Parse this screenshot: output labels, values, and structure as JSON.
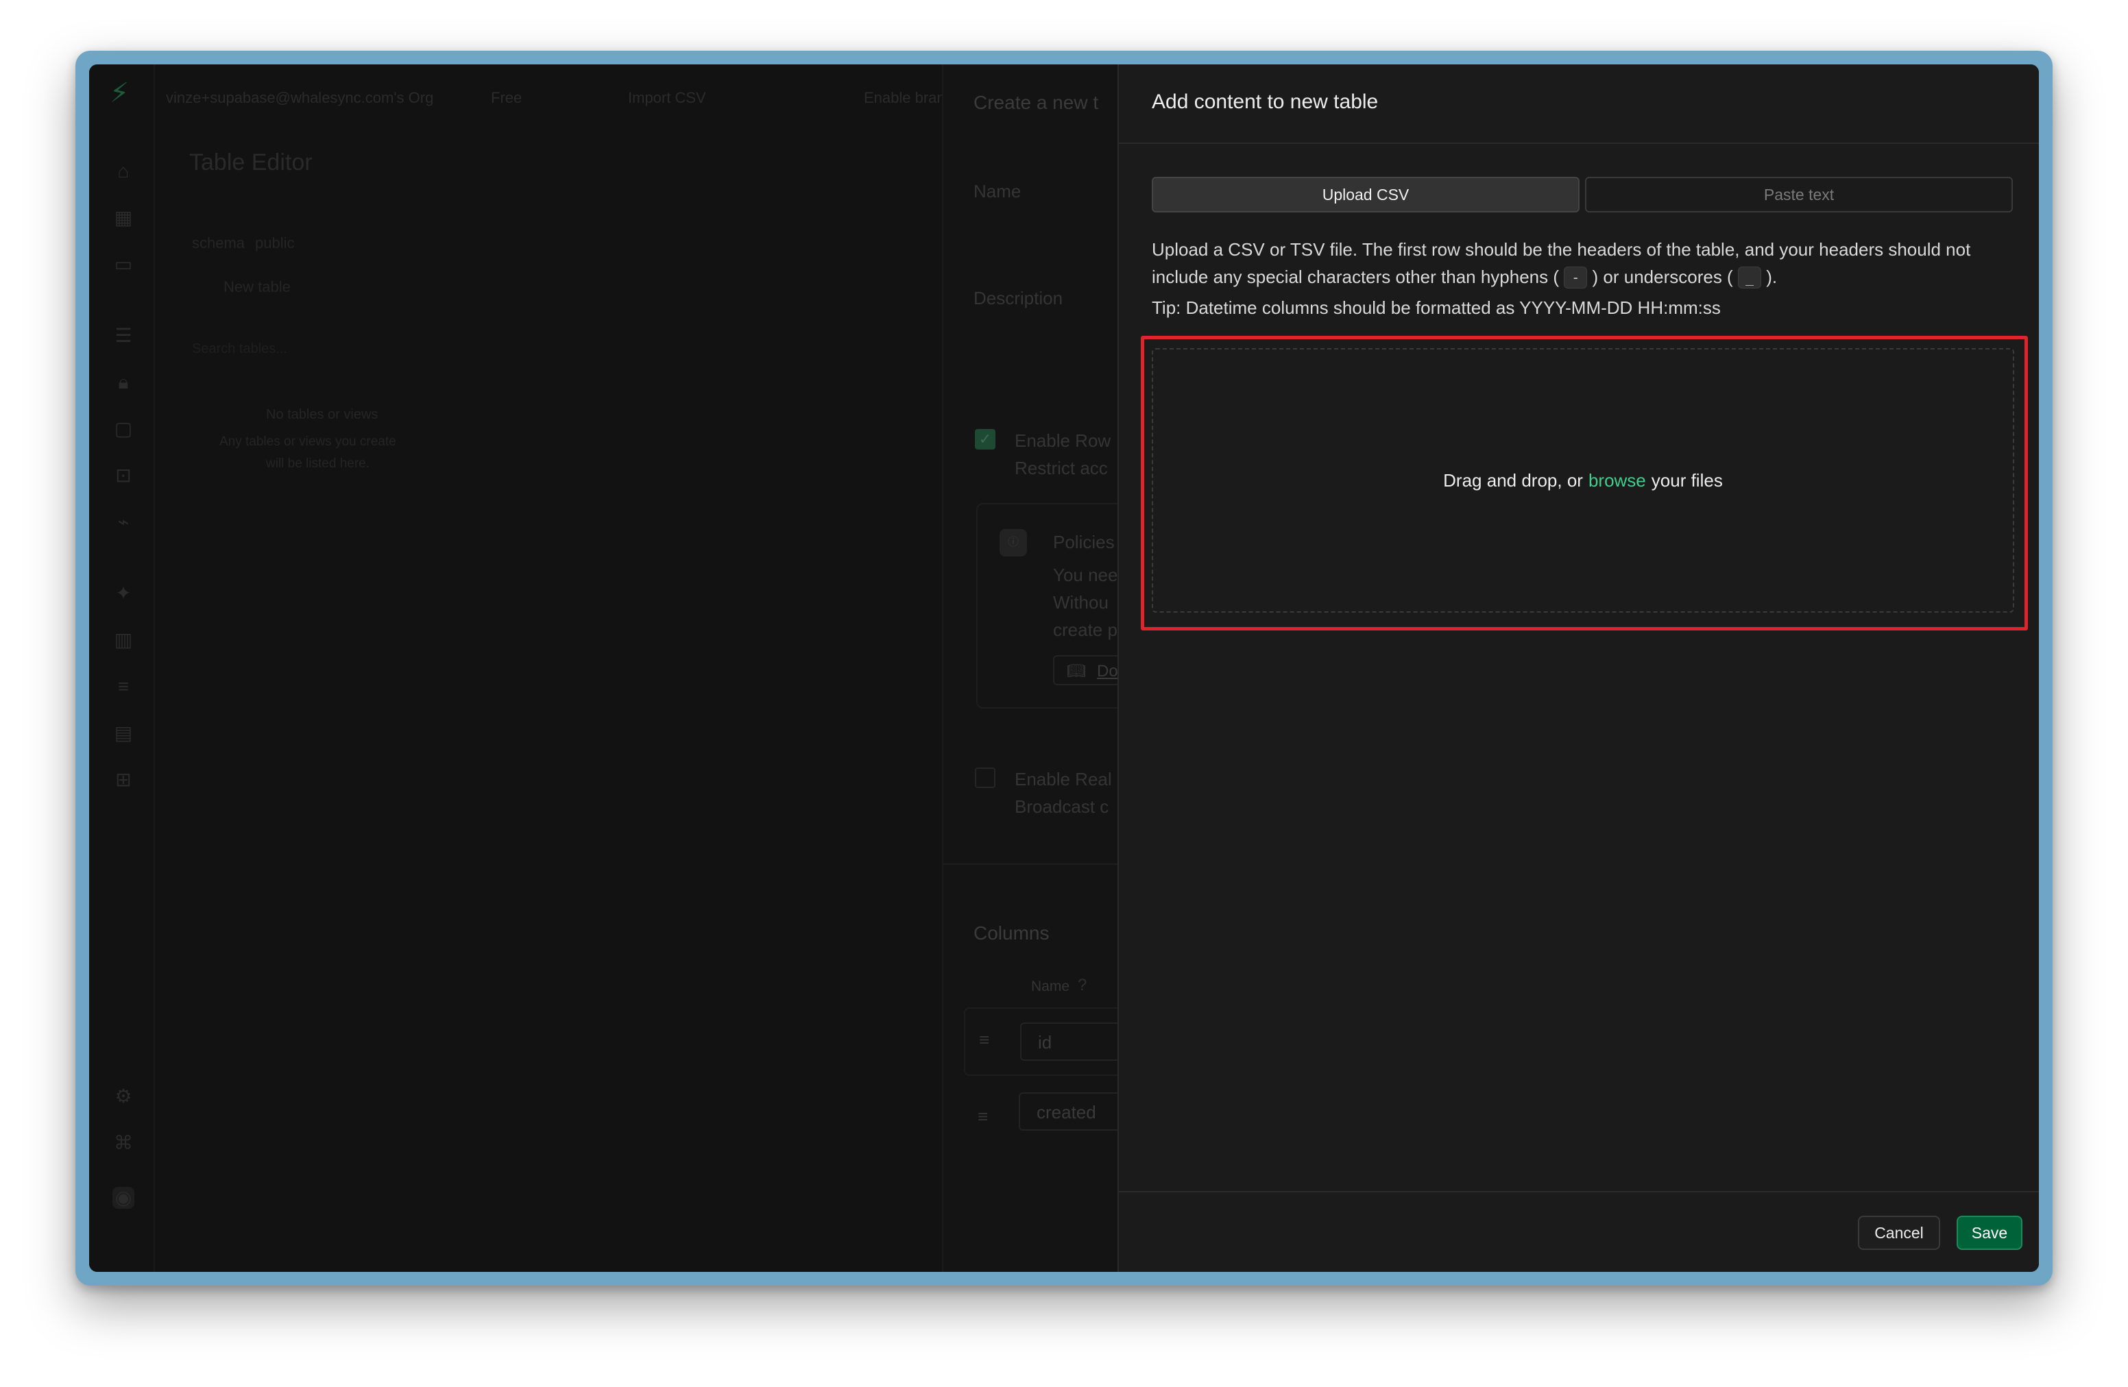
{
  "background_app": {
    "org": "vinze+supabase@whalesync.com's Org",
    "plan_badge": "Free",
    "import_csv": "Import CSV",
    "enable_branching": "Enable branching",
    "page_title": "Table Editor",
    "schema_label": "schema",
    "schema_value": "public",
    "new_table": "New table",
    "search_placeholder": "Search tables...",
    "empty_title": "No tables or views",
    "empty_line1": "Any tables or views you create",
    "empty_line2": "will be listed here.",
    "create_panel": {
      "title": "Create a new t",
      "name_label": "Name",
      "description_label": "Description",
      "rls_label": "Enable Row",
      "rls_sub": "Restrict acc",
      "policies_title": "Policies",
      "policies_line1": "You nee",
      "policies_line2": "Withou",
      "policies_line3": "create p",
      "docs_label": "Do",
      "realtime_label": "Enable Real",
      "realtime_sub": "Broadcast c",
      "columns_title": "Columns",
      "col_name_header": "Name",
      "col_1": "id",
      "col_2": "created"
    }
  },
  "dialog": {
    "title": "Add content to new table",
    "tabs": [
      {
        "label": "Upload CSV",
        "active": true
      },
      {
        "label": "Paste text",
        "active": false
      }
    ],
    "description_part1": "Upload a CSV or TSV file. The first row should be the headers of the table, and your headers should not include any special characters other than hyphens (",
    "hyphen_code": "-",
    "description_part2": ") or underscores (",
    "underscore_code": "_",
    "description_part3": ").",
    "tip": "Tip: Datetime columns should be formatted as YYYY-MM-DD HH:mm:ss",
    "dropzone": {
      "prefix": "Drag and drop, or",
      "link": "browse",
      "suffix": "your files"
    },
    "cancel_label": "Cancel",
    "save_label": "Save"
  },
  "colors": {
    "accent_green": "#3ecf8e",
    "save_bg": "#006239",
    "highlight_red": "#e0242c"
  },
  "icons": [
    "supabase-logo-icon",
    "home-icon",
    "table-icon",
    "terminal-icon",
    "database-icon",
    "lock-icon",
    "storage-icon",
    "functions-icon",
    "realtime-icon",
    "advisor-icon",
    "reports-icon",
    "logs-icon",
    "api-docs-icon",
    "integrations-icon",
    "settings-icon",
    "feedback-icon",
    "help-icon",
    "checkbox-checked-icon",
    "info-icon",
    "book-icon",
    "drag-handle-icon",
    "question-icon"
  ]
}
